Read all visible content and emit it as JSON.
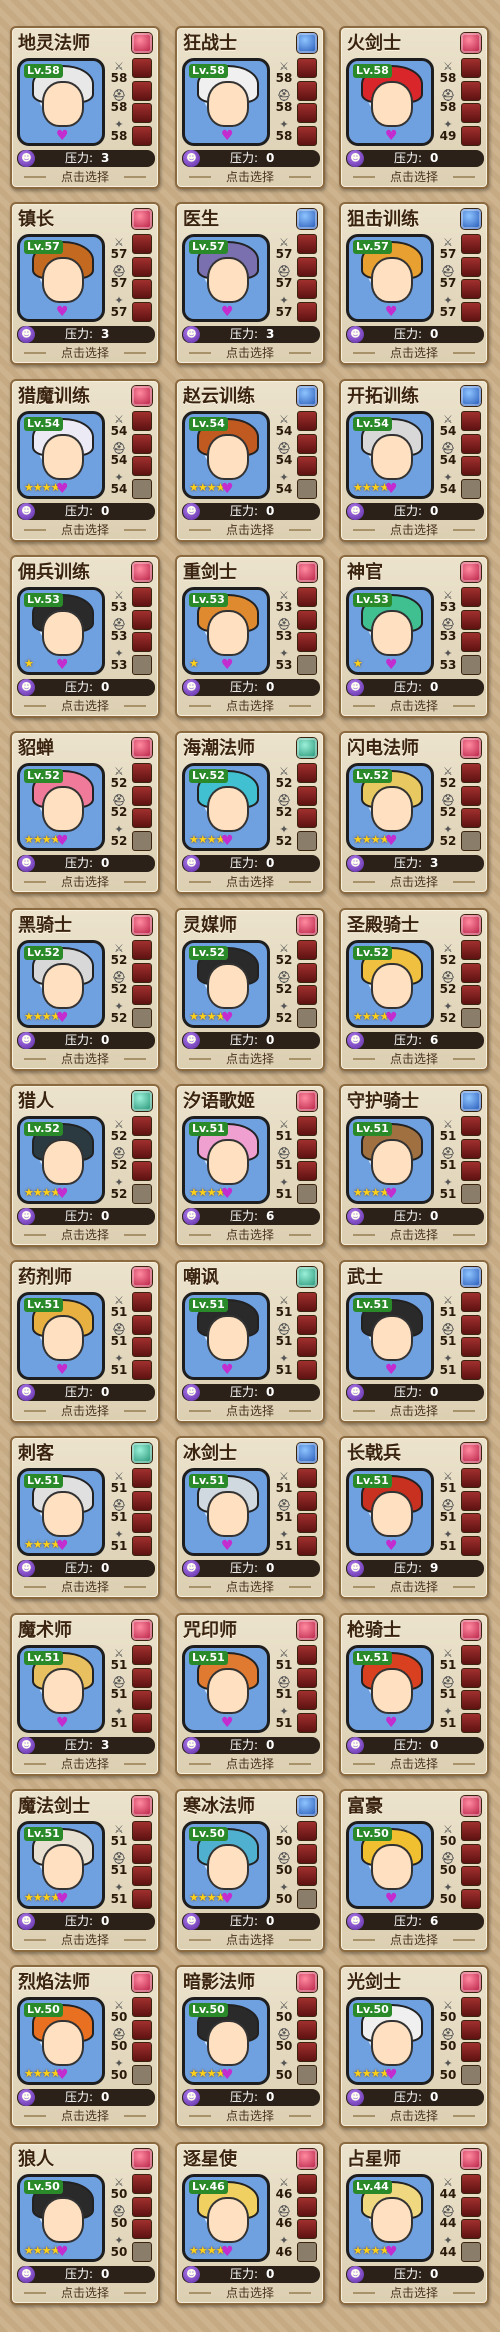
{
  "pressure_label": "压力:",
  "select_label": "点击选择",
  "cards": [
    {
      "title": "地灵法师",
      "elem": "red",
      "lv": "Lv.58",
      "stars": 0,
      "hp": "58",
      "atk": "58",
      "stat_level": "58",
      "pressure": "3",
      "hair": "#e8e8e8",
      "slots": [
        1,
        1,
        1,
        1
      ]
    },
    {
      "title": "狂战士",
      "elem": "blue",
      "lv": "Lv.58",
      "stars": 0,
      "hp": "58",
      "atk": "58",
      "stat_level": "58",
      "pressure": "0",
      "hair": "#f0f0f0",
      "slots": [
        1,
        1,
        1,
        1
      ]
    },
    {
      "title": "火剑士",
      "elem": "red",
      "lv": "Lv.58",
      "stars": 0,
      "hp": "58",
      "atk": "49",
      "stat_level": "58",
      "pressure": "0",
      "hair": "#d8262a",
      "slots": [
        1,
        1,
        1,
        1
      ]
    },
    {
      "title": "镇长",
      "elem": "red",
      "lv": "Lv.57",
      "stars": 0,
      "hp": "57",
      "atk": "57",
      "stat_level": "57",
      "pressure": "3",
      "hair": "#c46a20",
      "slots": [
        1,
        1,
        1,
        1
      ]
    },
    {
      "title": "医生",
      "elem": "blue",
      "lv": "Lv.57",
      "stars": 0,
      "hp": "57",
      "atk": "57",
      "stat_level": "57",
      "pressure": "3",
      "hair": "#7a70b0",
      "slots": [
        1,
        1,
        1,
        1
      ]
    },
    {
      "title": "狙击训练",
      "elem": "blue",
      "lv": "Lv.57",
      "stars": 0,
      "hp": "57",
      "atk": "57",
      "stat_level": "57",
      "pressure": "0",
      "hair": "#e8a030",
      "slots": [
        1,
        1,
        1,
        1
      ]
    },
    {
      "title": "猎魔训练",
      "elem": "red",
      "lv": "Lv.54",
      "stars": 4,
      "hp": "54",
      "atk": "54",
      "stat_level": "54",
      "pressure": "0",
      "hair": "#eceaf4",
      "slots": [
        1,
        1,
        1,
        0
      ]
    },
    {
      "title": "赵云训练",
      "elem": "blue",
      "lv": "Lv.54",
      "stars": 4,
      "hp": "54",
      "atk": "54",
      "stat_level": "54",
      "pressure": "0",
      "hair": "#c05a20",
      "slots": [
        1,
        1,
        1,
        0
      ]
    },
    {
      "title": "开拓训练",
      "elem": "blue",
      "lv": "Lv.54",
      "stars": 4,
      "hp": "54",
      "atk": "54",
      "stat_level": "54",
      "pressure": "0",
      "hair": "#d8d8d8",
      "slots": [
        1,
        1,
        1,
        0
      ]
    },
    {
      "title": "佣兵训练",
      "elem": "red",
      "lv": "Lv.53",
      "stars": 1,
      "hp": "53",
      "atk": "53",
      "stat_level": "53",
      "pressure": "0",
      "hair": "#2a2a2a",
      "slots": [
        1,
        1,
        1,
        0
      ]
    },
    {
      "title": "重剑士",
      "elem": "red",
      "lv": "Lv.53",
      "stars": 1,
      "hp": "53",
      "atk": "53",
      "stat_level": "53",
      "pressure": "0",
      "hair": "#e08a30",
      "slots": [
        1,
        1,
        1,
        0
      ]
    },
    {
      "title": "神官",
      "elem": "red",
      "lv": "Lv.53",
      "stars": 1,
      "hp": "53",
      "atk": "53",
      "stat_level": "53",
      "pressure": "0",
      "hair": "#40c090",
      "slots": [
        1,
        1,
        1,
        0
      ]
    },
    {
      "title": "貂蝉",
      "elem": "red",
      "lv": "Lv.52",
      "stars": 4,
      "hp": "52",
      "atk": "52",
      "stat_level": "52",
      "pressure": "0",
      "hair": "#f07a9a",
      "slots": [
        1,
        1,
        1,
        0
      ]
    },
    {
      "title": "海潮法师",
      "elem": "teal",
      "lv": "Lv.52",
      "stars": 4,
      "hp": "52",
      "atk": "52",
      "stat_level": "52",
      "pressure": "0",
      "hair": "#40c0d0",
      "slots": [
        1,
        1,
        1,
        0
      ]
    },
    {
      "title": "闪电法师",
      "elem": "red",
      "lv": "Lv.52",
      "stars": 4,
      "hp": "52",
      "atk": "52",
      "stat_level": "52",
      "pressure": "3",
      "hair": "#e8c860",
      "slots": [
        1,
        1,
        1,
        0
      ]
    },
    {
      "title": "黑骑士",
      "elem": "red",
      "lv": "Lv.52",
      "stars": 4,
      "hp": "52",
      "atk": "52",
      "stat_level": "52",
      "pressure": "0",
      "hair": "#d8d8d8",
      "slots": [
        1,
        1,
        1,
        0
      ]
    },
    {
      "title": "灵媒师",
      "elem": "red",
      "lv": "Lv.52",
      "stars": 4,
      "hp": "52",
      "atk": "52",
      "stat_level": "52",
      "pressure": "0",
      "hair": "#2a2a2a",
      "slots": [
        1,
        1,
        1,
        0
      ]
    },
    {
      "title": "圣殿骑士",
      "elem": "red",
      "lv": "Lv.52",
      "stars": 4,
      "hp": "52",
      "atk": "52",
      "stat_level": "52",
      "pressure": "6",
      "hair": "#f0c040",
      "slots": [
        1,
        1,
        1,
        0
      ]
    },
    {
      "title": "猎人",
      "elem": "teal",
      "lv": "Lv.52",
      "stars": 4,
      "hp": "52",
      "atk": "52",
      "stat_level": "52",
      "pressure": "0",
      "hair": "#2a3a40",
      "slots": [
        1,
        1,
        1,
        0
      ]
    },
    {
      "title": "汐语歌姬",
      "elem": "red",
      "lv": "Lv.51",
      "stars": 4,
      "hp": "51",
      "atk": "51",
      "stat_level": "51",
      "pressure": "6",
      "hair": "#f0a0d0",
      "slots": [
        1,
        1,
        1,
        0
      ]
    },
    {
      "title": "守护骑士",
      "elem": "blue",
      "lv": "Lv.51",
      "stars": 4,
      "hp": "51",
      "atk": "51",
      "stat_level": "51",
      "pressure": "0",
      "hair": "#a07040",
      "slots": [
        1,
        1,
        1,
        0
      ]
    },
    {
      "title": "药剂师",
      "elem": "red",
      "lv": "Lv.51",
      "stars": 0,
      "hp": "51",
      "atk": "51",
      "stat_level": "51",
      "pressure": "0",
      "hair": "#e8b040",
      "slots": [
        1,
        1,
        1,
        1
      ]
    },
    {
      "title": "嘲讽",
      "elem": "teal",
      "lv": "Lv.51",
      "stars": 0,
      "hp": "51",
      "atk": "51",
      "stat_level": "51",
      "pressure": "0",
      "hair": "#2a2a2a",
      "slots": [
        1,
        1,
        1,
        1
      ]
    },
    {
      "title": "武士",
      "elem": "blue",
      "lv": "Lv.51",
      "stars": 0,
      "hp": "51",
      "atk": "51",
      "stat_level": "51",
      "pressure": "0",
      "hair": "#2a2a2a",
      "slots": [
        1,
        1,
        1,
        1
      ]
    },
    {
      "title": "刺客",
      "elem": "teal",
      "lv": "Lv.51",
      "stars": 4,
      "hp": "51",
      "atk": "51",
      "stat_level": "51",
      "pressure": "0",
      "hair": "#e0e0e0",
      "slots": [
        1,
        1,
        1,
        1
      ]
    },
    {
      "title": "冰剑士",
      "elem": "blue",
      "lv": "Lv.51",
      "stars": 0,
      "hp": "51",
      "atk": "51",
      "stat_level": "51",
      "pressure": "0",
      "hair": "#d0d8e0",
      "slots": [
        1,
        1,
        1,
        1
      ]
    },
    {
      "title": "长戟兵",
      "elem": "red",
      "lv": "Lv.51",
      "stars": 0,
      "hp": "51",
      "atk": "51",
      "stat_level": "51",
      "pressure": "9",
      "hair": "#c83020",
      "slots": [
        1,
        1,
        1,
        1
      ]
    },
    {
      "title": "魔术师",
      "elem": "red",
      "lv": "Lv.51",
      "stars": 0,
      "hp": "51",
      "atk": "51",
      "stat_level": "51",
      "pressure": "3",
      "hair": "#e8c060",
      "slots": [
        1,
        1,
        1,
        1
      ]
    },
    {
      "title": "咒印师",
      "elem": "red",
      "lv": "Lv.51",
      "stars": 0,
      "hp": "51",
      "atk": "51",
      "stat_level": "51",
      "pressure": "0",
      "hair": "#e07a30",
      "slots": [
        1,
        1,
        1,
        1
      ]
    },
    {
      "title": "枪骑士",
      "elem": "red",
      "lv": "Lv.51",
      "stars": 0,
      "hp": "51",
      "atk": "51",
      "stat_level": "51",
      "pressure": "0",
      "hair": "#d84020",
      "slots": [
        1,
        1,
        1,
        1
      ]
    },
    {
      "title": "魔法剑士",
      "elem": "red",
      "lv": "Lv.51",
      "stars": 4,
      "hp": "51",
      "atk": "51",
      "stat_level": "51",
      "pressure": "0",
      "hair": "#e8e0d0",
      "slots": [
        1,
        1,
        1,
        1
      ]
    },
    {
      "title": "寒冰法师",
      "elem": "blue",
      "lv": "Lv.50",
      "stars": 4,
      "hp": "50",
      "atk": "50",
      "stat_level": "50",
      "pressure": "0",
      "hair": "#50b0d0",
      "slots": [
        1,
        1,
        1,
        0
      ]
    },
    {
      "title": "富豪",
      "elem": "red",
      "lv": "Lv.50",
      "stars": 0,
      "hp": "50",
      "atk": "50",
      "stat_level": "50",
      "pressure": "6",
      "hair": "#f0c030",
      "slots": [
        1,
        1,
        1,
        1
      ]
    },
    {
      "title": "烈焰法师",
      "elem": "red",
      "lv": "Lv.50",
      "stars": 4,
      "hp": "50",
      "atk": "50",
      "stat_level": "50",
      "pressure": "0",
      "hair": "#e87020",
      "slots": [
        1,
        1,
        1,
        0
      ]
    },
    {
      "title": "暗影法师",
      "elem": "red",
      "lv": "Lv.50",
      "stars": 4,
      "hp": "50",
      "atk": "50",
      "stat_level": "50",
      "pressure": "0",
      "hair": "#2a2a2a",
      "slots": [
        1,
        1,
        1,
        0
      ]
    },
    {
      "title": "光剑士",
      "elem": "red",
      "lv": "Lv.50",
      "stars": 4,
      "hp": "50",
      "atk": "50",
      "stat_level": "50",
      "pressure": "0",
      "hair": "#f0f0f0",
      "slots": [
        1,
        1,
        1,
        0
      ]
    },
    {
      "title": "狼人",
      "elem": "red",
      "lv": "Lv.50",
      "stars": 4,
      "hp": "50",
      "atk": "50",
      "stat_level": "50",
      "pressure": "0",
      "hair": "#2a2a2a",
      "slots": [
        1,
        1,
        1,
        0
      ]
    },
    {
      "title": "逐星使",
      "elem": "red",
      "lv": "Lv.46",
      "stars": 4,
      "hp": "46",
      "atk": "46",
      "stat_level": "46",
      "pressure": "0",
      "hair": "#f0d060",
      "slots": [
        1,
        1,
        1,
        0
      ]
    },
    {
      "title": "占星师",
      "elem": "red",
      "lv": "Lv.44",
      "stars": 4,
      "hp": "44",
      "atk": "44",
      "stat_level": "44",
      "pressure": "0",
      "hair": "#f0d880",
      "slots": [
        1,
        1,
        1,
        0
      ]
    }
  ]
}
